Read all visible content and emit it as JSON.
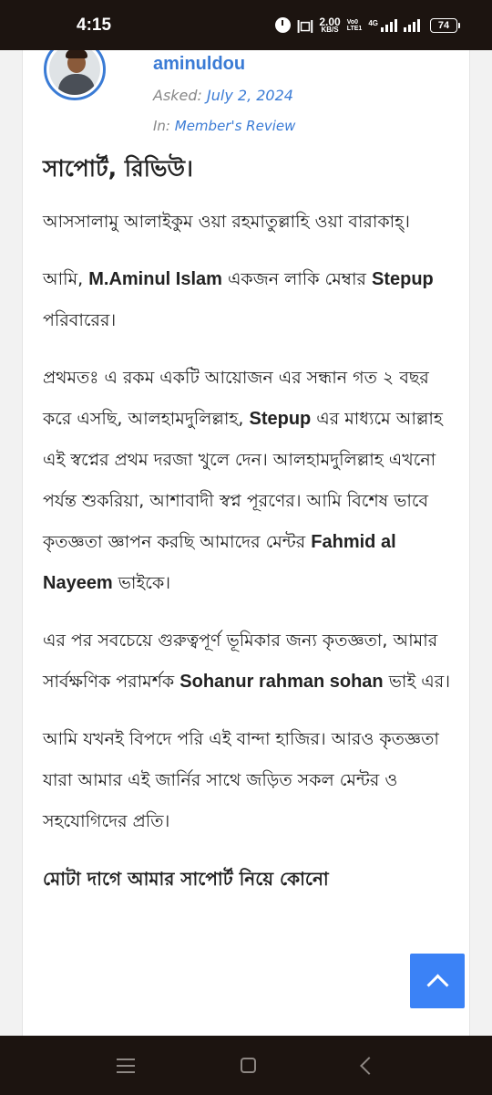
{
  "status": {
    "time": "4:15",
    "speed_value": "2.00",
    "speed_unit": "KB/S",
    "volte_top": "Vo0",
    "volte_bottom": "LTE1",
    "network": "4G",
    "battery": "74"
  },
  "post": {
    "author": "aminuldou",
    "asked_label": "Asked:",
    "asked_date": "July 2, 2024",
    "in_label": "In:",
    "category": "Member's Review",
    "title": "সাপোর্ট, রিভিউ।",
    "p1": "আসসালামু আলাইকুম ওয়া রহমাতুল্লাহি ওয়া বারাকাহ্।",
    "p2_a": "আমি, ",
    "p2_name": "M.Aminul Islam",
    "p2_b": " একজন লাকি মেম্বার ",
    "p2_brand": "Stepup",
    "p2_c": " পরিবারের।",
    "p3_a": "প্রথমতঃ এ রকম একটি আয়োজন এর সন্ধান গত ২ বছর করে এসছি, আলহামদুলিল্লাহ, ",
    "p3_brand": "Stepup",
    "p3_b": " এর মাধ্যমে আল্লাহ এই স্বপ্নের প্রথম দরজা খুলে দেন। আলহামদুলিল্লাহ এখনো পর্যন্ত শুকরিয়া, আশাবাদী স্বপ্ন পূরণের। আমি বিশেষ ভাবে কৃতজ্ঞতা জ্ঞাপন করছি আমাদের মেন্টর ",
    "p3_mentor": "Fahmid al Nayeem",
    "p3_c": " ভাইকে।",
    "p4_a": "এর পর সবচেয়ে গুরুত্বপূর্ণ ভূমিকার জন্য কৃতজ্ঞতা, আমার সার্বক্ষণিক পরামর্শক ",
    "p4_advisor": "Sohanur rahman sohan",
    "p4_b": " ভাই এর।",
    "p5": "আমি যখনই বিপদে পরি এই বান্দা হাজির। আরও কৃতজ্ঞতা যারা আমার এই জার্নির সাথে জড়িত সকল মেন্টর ও সহযোগিদের প্রতি।",
    "p6": "মোটা দাগে আমার সাপোর্ট নিয়ে কোনো"
  },
  "icons": {
    "back_to_top": "chevron-up-icon",
    "nav_recents": "menu-icon",
    "nav_home": "home-icon",
    "nav_back": "back-icon"
  },
  "colors": {
    "accent": "#3a7bd5",
    "button": "#3b82f6",
    "system_bar": "#1c1410"
  }
}
